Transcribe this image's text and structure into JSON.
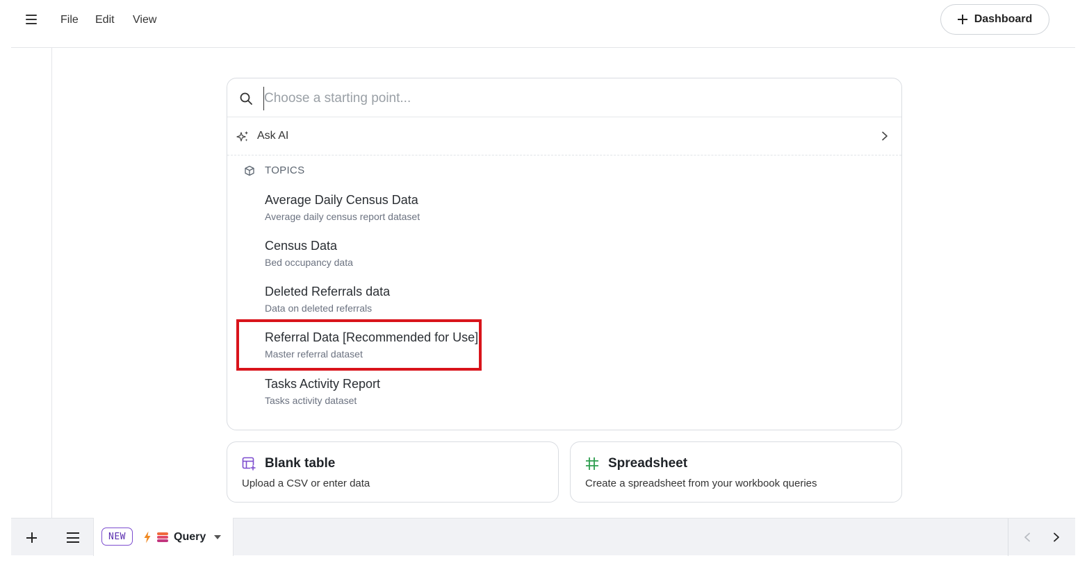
{
  "menu": {
    "items": [
      "File",
      "Edit",
      "View"
    ],
    "dashboard_label": "Dashboard"
  },
  "picker": {
    "search_placeholder": "Choose a starting point...",
    "ask_ai_label": "Ask AI",
    "topics_header": "TOPICS",
    "topics": [
      {
        "title": "Average Daily Census Data",
        "description": "Average daily census report dataset"
      },
      {
        "title": "Census Data",
        "description": "Bed occupancy data"
      },
      {
        "title": "Deleted Referrals data",
        "description": "Data on deleted referrals"
      },
      {
        "title": "Referral Data [Recommended for Use]",
        "description": "Master referral dataset"
      },
      {
        "title": "Tasks Activity Report",
        "description": "Tasks activity dataset"
      }
    ]
  },
  "options": {
    "blank_table": {
      "title": "Blank table",
      "description": "Upload a CSV or enter data"
    },
    "spreadsheet": {
      "title": "Spreadsheet",
      "description": "Create a spreadsheet from your workbook queries"
    }
  },
  "bottom": {
    "tab_badge": "NEW",
    "tab_label": "Query"
  },
  "colors": {
    "highlight": "#d9141b",
    "badge": "#7c4ccf",
    "blank_table_icon": "#7c4ccf",
    "spreadsheet_icon": "#2e9e4f"
  },
  "icons": [
    "hamburger-icon",
    "plus-icon",
    "search-icon",
    "sparkle-icon",
    "chevron-right-icon",
    "cube-icon",
    "table-icon",
    "grid-icon",
    "lightning-icon",
    "database-icon",
    "caret-down-icon",
    "chevron-left-icon"
  ]
}
